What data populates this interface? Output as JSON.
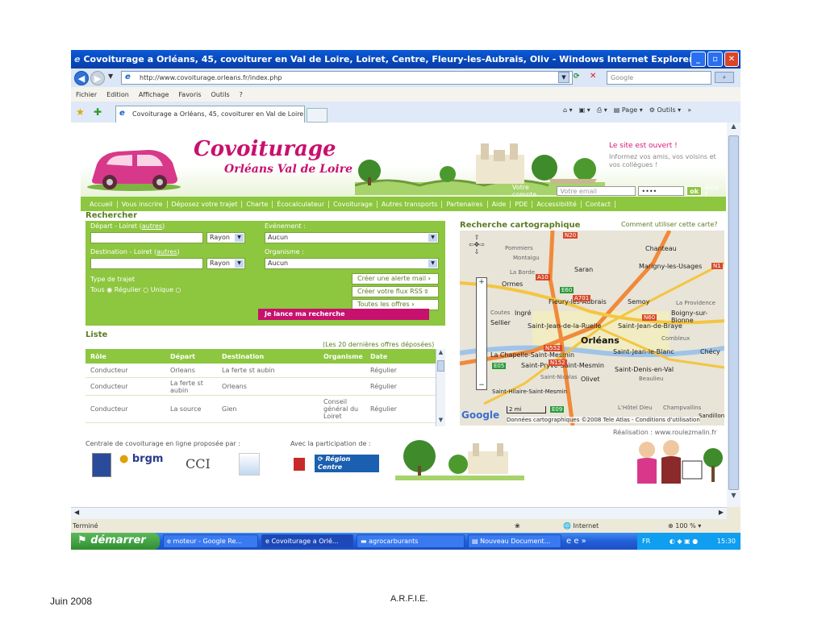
{
  "window": {
    "title": "Covoiturage a Orléans, 45, covoiturer en Val de Loire, Loiret, Centre, Fleury-les-Aubrais, Oliv - Windows Internet Explorer"
  },
  "browser": {
    "url": "http://www.covoiturage.orleans.fr/index.php",
    "search_placeholder": "Google",
    "menu": [
      "Fichier",
      "Edition",
      "Affichage",
      "Favoris",
      "Outils",
      "?"
    ],
    "tab": "Covoiturage a Orléans, 45, covoiturer en Val de Loire...",
    "cmd": {
      "page": "Page",
      "tools": "Outils"
    }
  },
  "site": {
    "logo_main": "Covoiturage",
    "logo_sub": "Orléans Val de Loire",
    "open_msg": "Le site est ouvert !",
    "invite": "Informez vos amis, vos voisins et vos collègues !",
    "account_label": "Votre compte",
    "email_placeholder": "Votre email",
    "password_mask": "••••",
    "ok": "ok",
    "help": "Aide ?",
    "nav": [
      "Accueil",
      "Vous inscrire",
      "Déposez votre trajet",
      "Charte",
      "Écocalculateur",
      "Covoiturage",
      "Autres transports",
      "Partenaires",
      "Aide",
      "PDE",
      "Accessibilité",
      "Contact"
    ]
  },
  "search": {
    "title": "Rechercher",
    "depart": "Départ - Loiret",
    "autres": "autres",
    "rayon": "Rayon",
    "destination": "Destination - Loiret",
    "evenement": "Evénement :",
    "organisme": "Organisme :",
    "aucun": "Aucun",
    "type": "Type de trajet",
    "tous": "Tous",
    "regulier": "Régulier",
    "unique": "Unique",
    "btn_alert": "Créer une alerte mail",
    "btn_rss": "Créer votre flux RSS",
    "btn_all": "Toutes les offres",
    "submit": "Je lance ma recherche"
  },
  "list": {
    "title": "Liste",
    "count": "(Les 20 dernières offres déposées)",
    "headers": [
      "Rôle",
      "Départ",
      "Destination",
      "Organisme",
      "Date"
    ],
    "rows": [
      [
        "Conducteur",
        "Orleans",
        "La ferte st aubin",
        "",
        "Régulier"
      ],
      [
        "Conducteur",
        "La ferte st aubin",
        "Orleans",
        "",
        "Régulier"
      ],
      [
        "Conducteur",
        "La source",
        "Gien",
        "Conseil général du Loiret",
        "Régulier"
      ]
    ]
  },
  "map": {
    "title": "Recherche cartographique",
    "help": "Comment utiliser cette carte?",
    "towns": [
      "Pommiers",
      "Chanteau",
      "Montaigu",
      "Saran",
      "Marigny-les-Usages",
      "La Borde",
      "Ormes",
      "Fleury-les-Aubrais",
      "Semoy",
      "La Providence",
      "Boigny-sur-Bionne",
      "Coutes",
      "Ingré",
      "Sellier",
      "Saint-Jean-de-la-Ruelle",
      "Saint-Jean-de-Braye",
      "Orléans",
      "Combleux",
      "Saint-Jean-le-Blanc",
      "Chécy",
      "La Chapelle-Saint-Mesmin",
      "Saint-Pryvé-Saint-Mesmin",
      "Saint-Denis-en-Val",
      "Olivet",
      "Beaulieu",
      "Saint-Hilaire-Saint-Mesmin",
      "Champvallins",
      "Sandillon",
      "Saint-Nicolas",
      "L'Hôtel Dieu"
    ],
    "roads": [
      "N20",
      "A10",
      "E60",
      "A701",
      "N60",
      "N552",
      "N152",
      "E05",
      "E09",
      "N1"
    ],
    "scale": "2 mi",
    "copyright": "Données cartographiques ©2008 Tele Atlas - Conditions d'utilisation"
  },
  "footer_site": {
    "realisation": "Réalisation : www.roulezmalin.fr",
    "centrale": "Centrale de covoiturage en ligne proposée par :",
    "participation": "Avec la participation de :",
    "brgm": "brgm",
    "cci": "CCI",
    "region": "Région Centre"
  },
  "statusbar": {
    "left": "Terminé",
    "zone": "Internet",
    "zoom": "100 %"
  },
  "taskbar": {
    "start": "démarrer",
    "tasks": [
      "moteur - Google Re...",
      "Covoiturage a Orlé...",
      "agrocarburants",
      "Nouveau Document..."
    ],
    "lang": "FR",
    "time": "15:30"
  },
  "slide": {
    "date": "Juin 2008",
    "org": "A.R.F.I.E."
  },
  "colors": {
    "xp_blue": "#0a5bd8",
    "site_green": "#8dc63f",
    "brand_pink": "#c8106e"
  }
}
